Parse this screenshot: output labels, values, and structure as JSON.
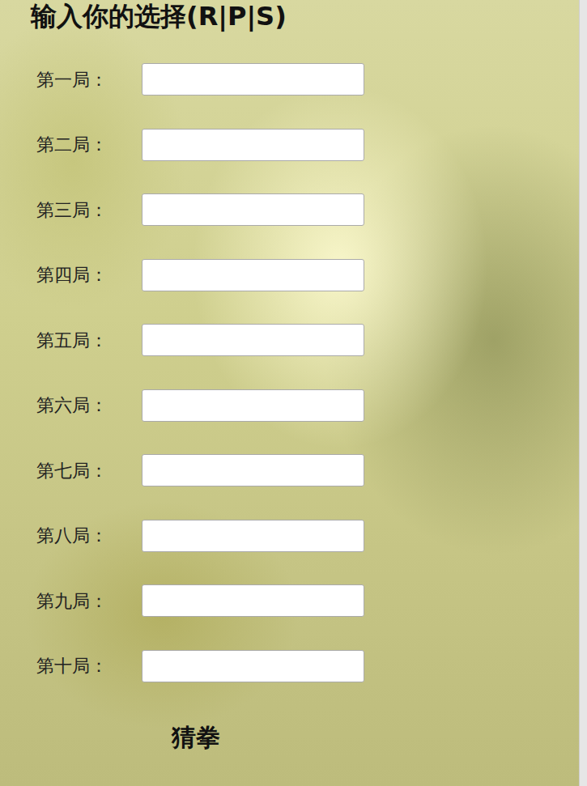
{
  "title": "输入你的选择(R|P|S)",
  "rounds": [
    {
      "label": "第一局：",
      "value": ""
    },
    {
      "label": "第二局：",
      "value": ""
    },
    {
      "label": "第三局：",
      "value": ""
    },
    {
      "label": "第四局：",
      "value": ""
    },
    {
      "label": "第五局：",
      "value": ""
    },
    {
      "label": "第六局：",
      "value": ""
    },
    {
      "label": "第七局：",
      "value": ""
    },
    {
      "label": "第八局：",
      "value": ""
    },
    {
      "label": "第九局：",
      "value": ""
    },
    {
      "label": "第十局：",
      "value": ""
    }
  ],
  "button": "猜拳"
}
